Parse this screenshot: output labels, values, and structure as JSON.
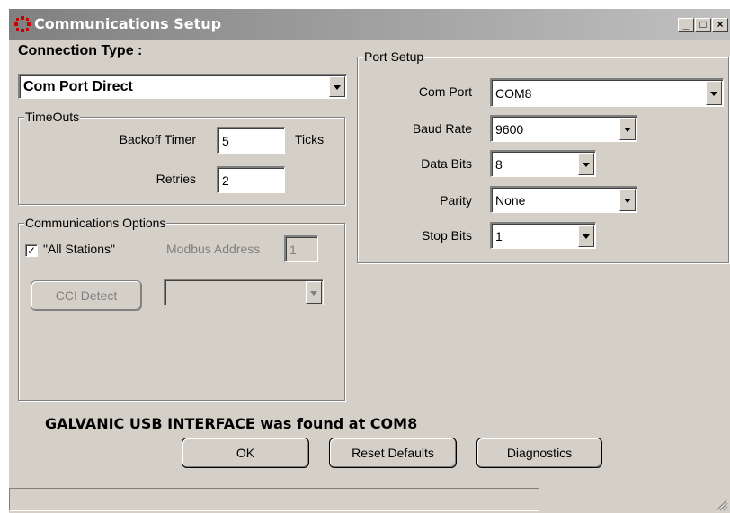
{
  "window": {
    "title": "Communications Setup"
  },
  "connection": {
    "label": "Connection Type :",
    "value": "Com Port Direct"
  },
  "timeouts": {
    "legend": "TimeOuts",
    "backoff_label": "Backoff Timer",
    "backoff_value": "5",
    "backoff_unit": "Ticks",
    "retries_label": "Retries",
    "retries_value": "2"
  },
  "comm_options": {
    "legend": "Communications Options",
    "all_stations_label": "\"All Stations\"",
    "all_stations_checked": true,
    "modbus_label": "Modbus Address",
    "modbus_value": "1",
    "cci_button": "CCI Detect",
    "cci_select_value": ""
  },
  "port_setup": {
    "legend": "Port Setup",
    "com_port_label": "Com Port",
    "com_port_value": "COM8",
    "baud_label": "Baud Rate",
    "baud_value": "9600",
    "data_bits_label": "Data Bits",
    "data_bits_value": "8",
    "parity_label": "Parity",
    "parity_value": "None",
    "stop_bits_label": "Stop Bits",
    "stop_bits_value": "1"
  },
  "status_message": "GALVANIC USB INTERFACE was found at COM8",
  "buttons": {
    "ok": "OK",
    "reset": "Reset Defaults",
    "diagnostics": "Diagnostics"
  },
  "colors": {
    "face": "#d4d0c8",
    "titlebar_start": "#808080",
    "titlebar_end": "#c0c0c0",
    "title_icon": "#cc0000"
  }
}
